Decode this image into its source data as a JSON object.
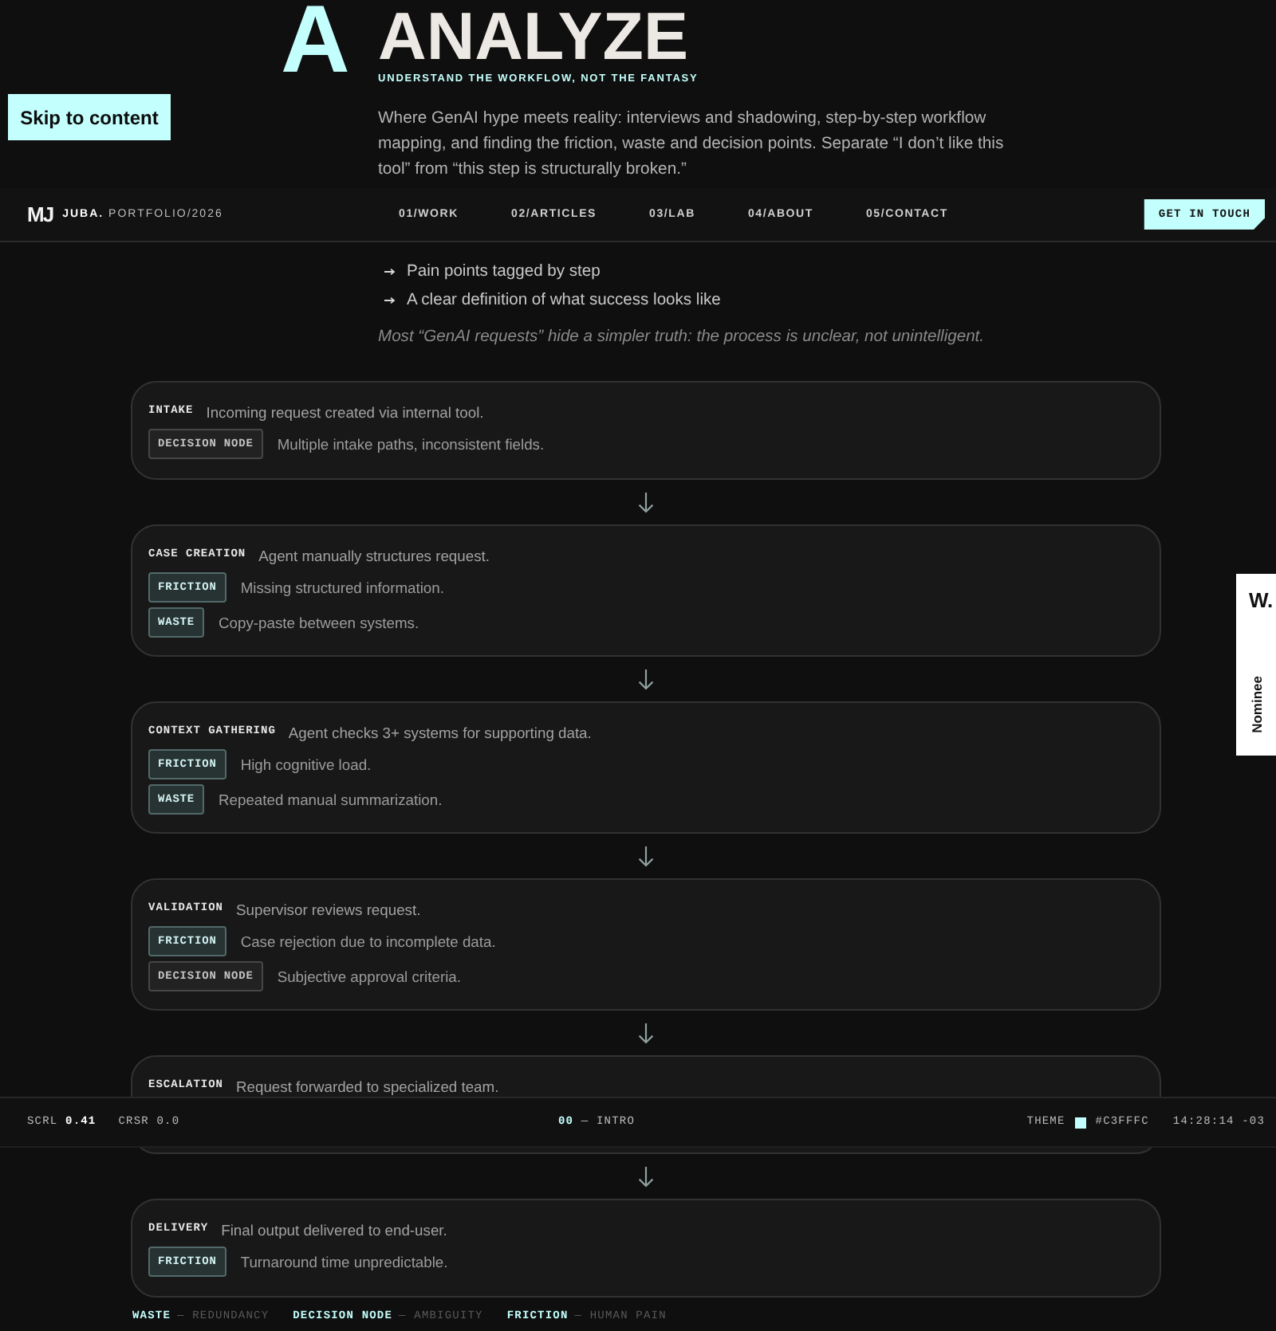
{
  "skip_link": {
    "label": "Skip to content"
  },
  "section": {
    "letter": "A",
    "title": "ANALYZE",
    "subtitle": "UNDERSTAND THE WORKFLOW, NOT THE FANTASY",
    "intro": "Where GenAI hype meets reality: interviews and shadowing, step-by-step workflow mapping, and finding the friction, waste and decision points. Separate “I don’t like this tool” from “this step is structurally broken.”"
  },
  "nav": {
    "logo": "MJ",
    "brand": "**JUBA.** PORTFOLIO/2026",
    "links": [
      {
        "label": "01/WORK"
      },
      {
        "label": "02/ARTICLES"
      },
      {
        "label": "03/LAB"
      },
      {
        "label": "04/ABOUT"
      },
      {
        "label": "05/CONTACT"
      }
    ],
    "cta": "GET IN TOUCH"
  },
  "deliverables": [
    "Pain points tagged by step",
    "A clear definition of what success looks like"
  ],
  "note": "Most “GenAI requests” hide a simpler truth: the process is unclear, not unintelligent.",
  "workflow": [
    {
      "stage": "INTAKE",
      "description": "Incoming request created via internal tool.",
      "tags": [
        {
          "kind": "decision",
          "label": "DECISION NODE",
          "text": "Multiple intake paths, inconsistent fields."
        }
      ]
    },
    {
      "stage": "CASE CREATION",
      "description": "Agent manually structures request.",
      "tags": [
        {
          "kind": "friction",
          "label": "FRICTION",
          "text": "Missing structured information."
        },
        {
          "kind": "waste",
          "label": "WASTE",
          "text": "Copy-paste between systems."
        }
      ]
    },
    {
      "stage": "CONTEXT GATHERING",
      "description": "Agent checks 3+ systems for supporting data.",
      "tags": [
        {
          "kind": "friction",
          "label": "FRICTION",
          "text": "High cognitive load."
        },
        {
          "kind": "waste",
          "label": "WASTE",
          "text": "Repeated manual summarization."
        }
      ]
    },
    {
      "stage": "VALIDATION",
      "description": "Supervisor reviews request.",
      "tags": [
        {
          "kind": "friction",
          "label": "FRICTION",
          "text": "Case rejection due to incomplete data."
        },
        {
          "kind": "decision",
          "label": "DECISION NODE",
          "text": "Subjective approval criteria."
        }
      ]
    },
    {
      "stage": "ESCALATION",
      "description": "Request forwarded to specialized team."
    },
    {
      "stage": "DELIVERY",
      "description": "Final output delivered to end-user.",
      "tags": [
        {
          "kind": "friction",
          "label": "FRICTION",
          "text": "Turnaround time unpredictable."
        }
      ]
    }
  ],
  "legend": [
    {
      "term": "WASTE",
      "meaning": "— REDUNDANCY"
    },
    {
      "term": "DECISION NODE",
      "meaning": "— AMBIGUITY"
    },
    {
      "term": "FRICTION",
      "meaning": "— HUMAN PAIN"
    }
  ],
  "status_bar": {
    "scroll": "SCRL **0.41**",
    "cursor": "CRSR 0.0",
    "section": "**00** — INTRO",
    "theme": {
      "label": "THEME",
      "color": "#c3fffc",
      "value": "#C3FFFC"
    },
    "time": "14:28:14 -03"
  },
  "badge": {
    "mark": "W.",
    "label": "Nominee"
  }
}
